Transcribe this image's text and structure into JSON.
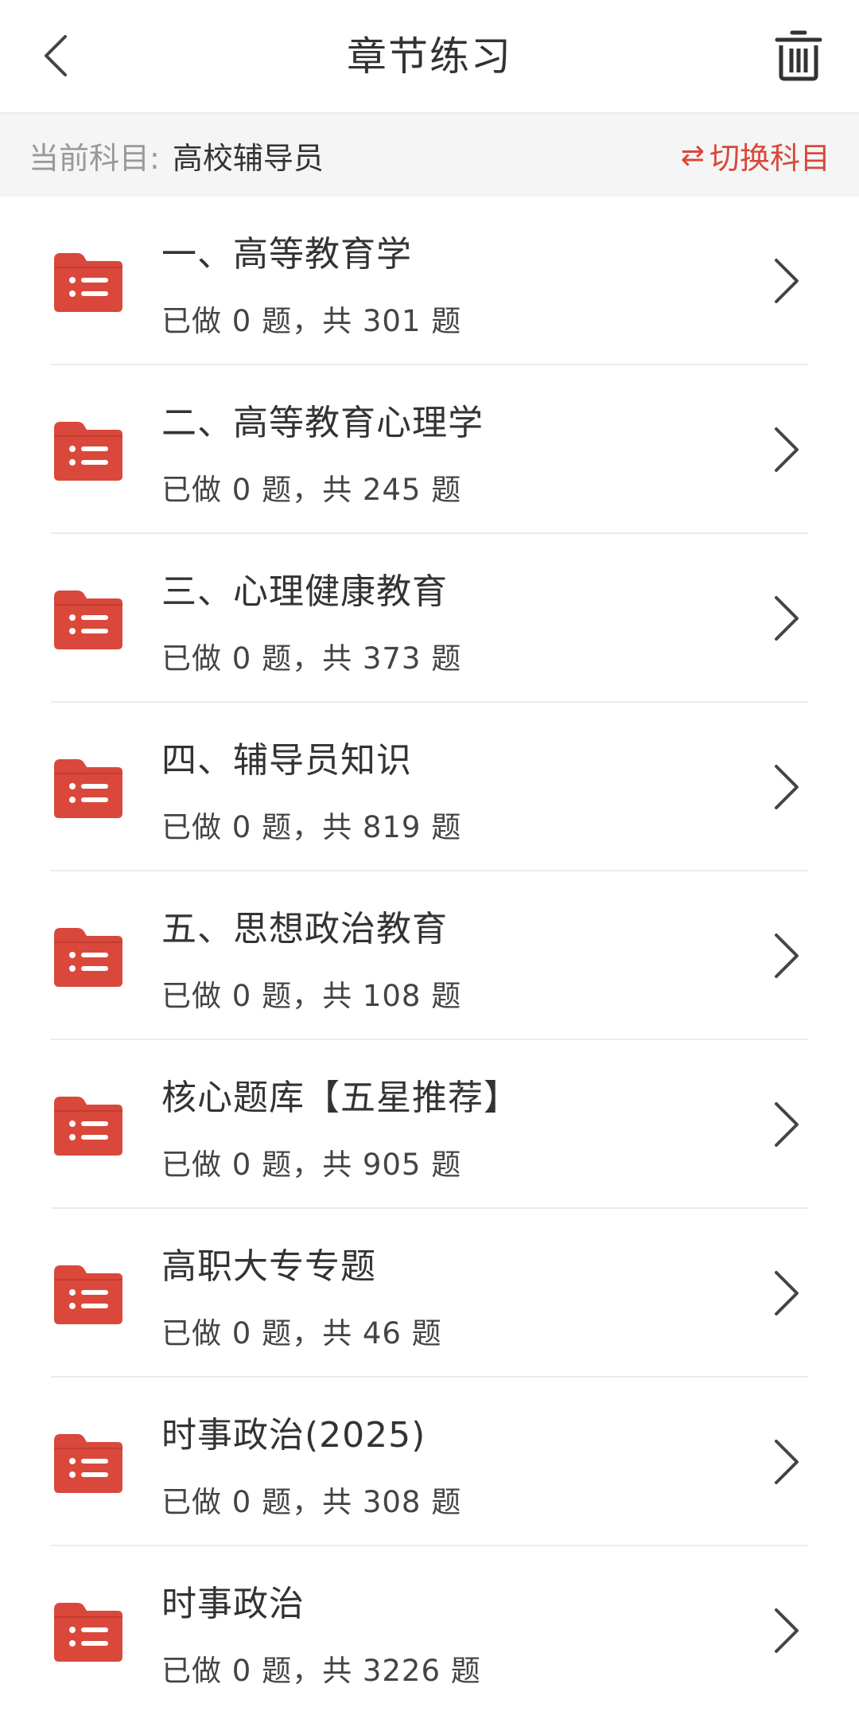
{
  "header": {
    "title": "章节练习",
    "back_icon": "chevron-left-icon",
    "trash_icon": "trash-icon"
  },
  "subject_bar": {
    "label": "当前科目:",
    "subject": "高校辅导员",
    "switch_icon": "⇄",
    "switch_label": "切换科目"
  },
  "colors": {
    "accent": "#d9483b",
    "folder": "#d9483b"
  },
  "chapters": [
    {
      "title": "一、高等教育学",
      "progress": "已做 0 题，共 301 题"
    },
    {
      "title": "二、高等教育心理学",
      "progress": "已做 0 题，共 245 题"
    },
    {
      "title": "三、心理健康教育",
      "progress": "已做 0 题，共 373 题"
    },
    {
      "title": "四、辅导员知识",
      "progress": "已做 0 题，共 819 题"
    },
    {
      "title": "五、思想政治教育",
      "progress": "已做 0 题，共 108 题"
    },
    {
      "title": "核心题库【五星推荐】",
      "progress": "已做 0 题，共 905 题"
    },
    {
      "title": "高职大专专题",
      "progress": "已做 0 题，共 46 题"
    },
    {
      "title": "时事政治(2025)",
      "progress": "已做 0 题，共 308 题"
    },
    {
      "title": "时事政治",
      "progress": "已做 0 题，共 3226 题"
    }
  ]
}
